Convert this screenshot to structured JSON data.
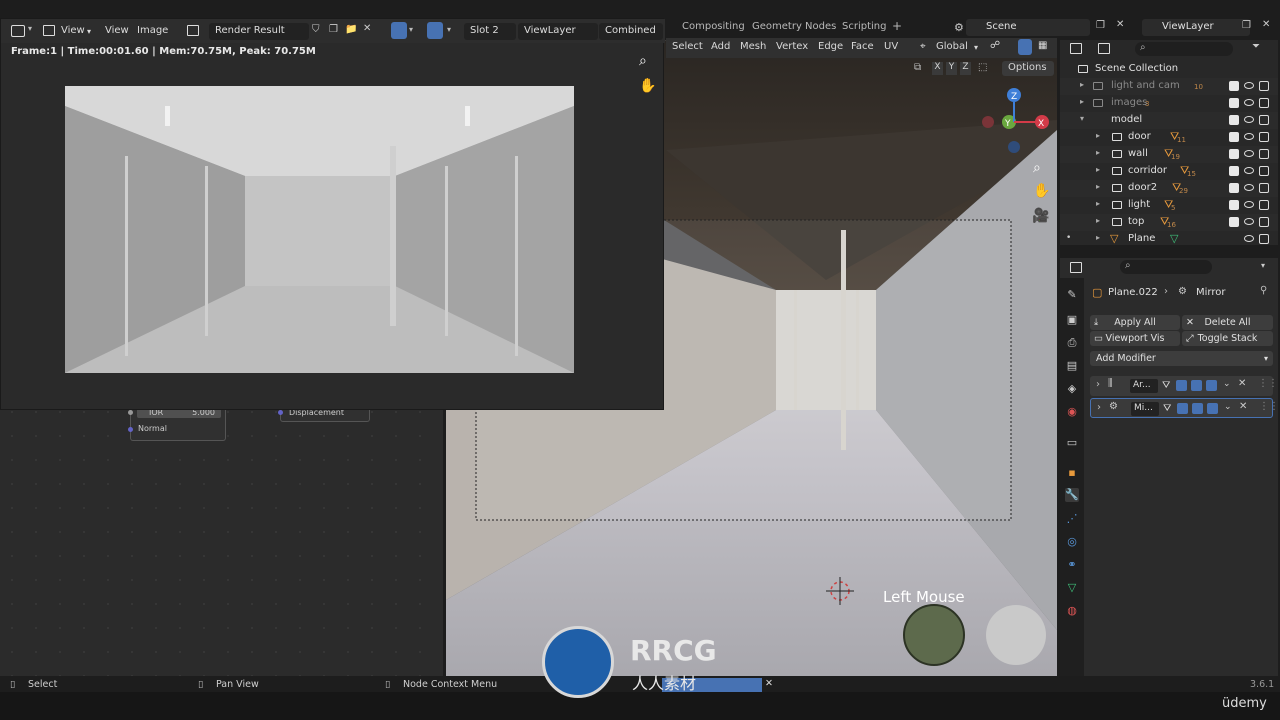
{
  "workspace_tabs": [
    "Compositing",
    "Geometry Nodes",
    "Scripting",
    "+"
  ],
  "scene": {
    "name": "Scene",
    "view_layer": "ViewLayer"
  },
  "render_window": {
    "menus": [
      "View",
      "View",
      "Image"
    ],
    "image_name": "Render Result",
    "slot": "Slot 2",
    "view_layer": "ViewLayer",
    "pass": "Combined",
    "stats": "Frame:1 | Time:00:01.60 | Mem:70.75M, Peak: 70.75M"
  },
  "viewport": {
    "menus": [
      "Select",
      "Add",
      "Mesh",
      "Vertex",
      "Edge",
      "Face",
      "UV"
    ],
    "orientation": "Global",
    "axes": [
      "X",
      "Y",
      "Z"
    ],
    "options_label": "Options",
    "gizmo": {
      "z": "Z",
      "y": "Y",
      "x": "X"
    },
    "screencast_key": "Left Mouse"
  },
  "node_editor": {
    "node1": {
      "ior_label": "IOR",
      "ior_value": "5.000",
      "normal_label": "Normal"
    },
    "node2": {
      "displacement_label": "Displacement"
    }
  },
  "outliner": {
    "root": "Scene Collection",
    "rows": [
      {
        "label": "light and cam",
        "badge": "10",
        "dim": true
      },
      {
        "label": "images",
        "badge": "3",
        "dim": true
      },
      {
        "label": "model",
        "badge": "",
        "dim": false
      },
      {
        "label": "door",
        "badge": "11",
        "dim": false
      },
      {
        "label": "wall",
        "badge": "19",
        "dim": false
      },
      {
        "label": "corridor",
        "badge": "15",
        "dim": false
      },
      {
        "label": "door2",
        "badge": "29",
        "dim": false
      },
      {
        "label": "light",
        "badge": "5",
        "dim": false
      },
      {
        "label": "top",
        "badge": "16",
        "dim": false
      },
      {
        "label": "Plane",
        "badge": "",
        "dim": false
      }
    ]
  },
  "properties": {
    "object": "Plane.022",
    "modifier_crumb": "Mirror",
    "apply_all": "Apply All",
    "delete_all": "Delete All",
    "viewport_vis": "Viewport Vis",
    "toggle_stack": "Toggle Stack",
    "add_modifier": "Add Modifier",
    "modifiers": [
      {
        "name": "Ar..."
      },
      {
        "name": "Mi..."
      }
    ]
  },
  "statusbar": {
    "select": "Select",
    "pan_view": "Pan View",
    "node_context_menu": "Node Context Menu",
    "version": "3.6.1"
  },
  "watermark": {
    "title": "RRCG",
    "subtitle": "人人素材",
    "brand": "üdemy"
  },
  "colors": {
    "accent_blue": "#4772b3",
    "object_orange": "#e89a3c",
    "mesh_green": "#3fc07a"
  }
}
